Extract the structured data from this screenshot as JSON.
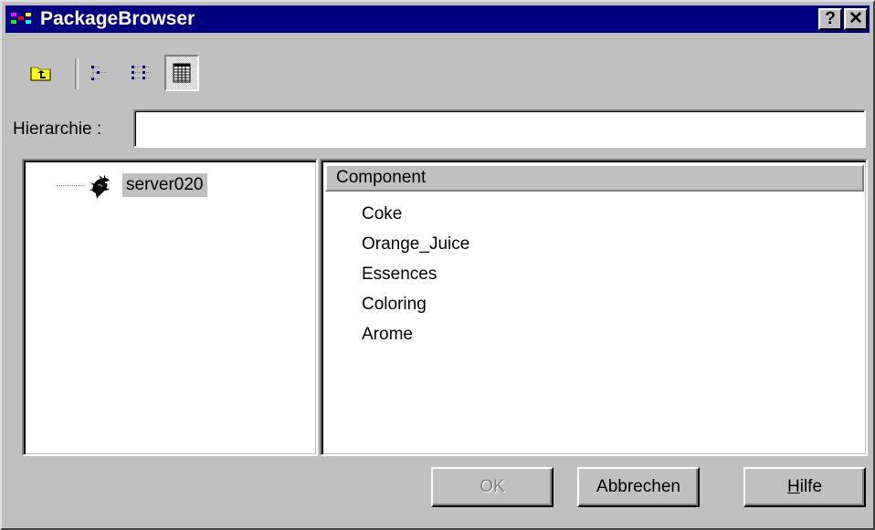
{
  "window": {
    "title": "PackageBrowser",
    "help_button": "?",
    "close_button": "✕"
  },
  "toolbar": {
    "icons": [
      "folder-up-icon",
      "tree-view-icon",
      "list-view-icon",
      "details-view-icon"
    ],
    "active_view": "details"
  },
  "hierarchy": {
    "label": "Hierarchie :",
    "value": ""
  },
  "tree": {
    "root": {
      "label": "server020",
      "icon": "server-icon",
      "selected": true
    }
  },
  "list": {
    "column_header": "Component",
    "items": [
      "Coke",
      "Orange_Juice",
      "Essences",
      "Coloring",
      "Arome"
    ]
  },
  "buttons": {
    "ok": "OK",
    "cancel": "Abbrechen",
    "help_rest": "ilfe",
    "help_mnemonic": "H"
  },
  "colors": {
    "titlebar": "#000080",
    "face": "#c0c0c0",
    "selection": "#c0c0c0"
  }
}
